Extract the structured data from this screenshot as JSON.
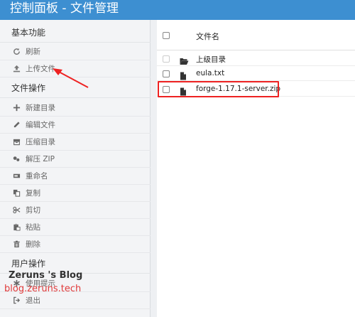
{
  "app": {
    "title": "控制面板 - 文件管理"
  },
  "sidebar": {
    "sections": [
      {
        "title": "基本功能",
        "items": [
          {
            "label": "刷新",
            "icon": "refresh-icon"
          },
          {
            "label": "上传文件",
            "icon": "upload-icon"
          }
        ]
      },
      {
        "title": "文件操作",
        "items": [
          {
            "label": "新建目录",
            "icon": "plus-icon"
          },
          {
            "label": "编辑文件",
            "icon": "pencil-icon"
          },
          {
            "label": "压缩目录",
            "icon": "archive-icon"
          },
          {
            "label": "解压 ZIP",
            "icon": "extract-icon"
          },
          {
            "label": "重命名",
            "icon": "rename-icon"
          },
          {
            "label": "复制",
            "icon": "copy-icon"
          },
          {
            "label": "剪切",
            "icon": "cut-icon"
          },
          {
            "label": "粘贴",
            "icon": "paste-icon"
          },
          {
            "label": "删除",
            "icon": "trash-icon"
          }
        ]
      },
      {
        "title": "用户操作",
        "items": [
          {
            "label": "使用提示",
            "icon": "asterisk-icon"
          },
          {
            "label": "退出",
            "icon": "logout-icon"
          }
        ]
      }
    ]
  },
  "files": {
    "header": "文件名",
    "rows": [
      {
        "name": "上级目录",
        "icon": "folder-open-icon"
      },
      {
        "name": "eula.txt",
        "icon": "file-icon"
      },
      {
        "name": "forge-1.17.1-server.zip",
        "icon": "file-icon"
      }
    ]
  },
  "watermark": {
    "line1": "Zeruns 's Blog",
    "line2": "blog.zeruns.tech"
  },
  "colors": {
    "titlebar": "#3d8fd1",
    "highlight": "#ee2222",
    "watermark_red": "#e03a3a"
  }
}
